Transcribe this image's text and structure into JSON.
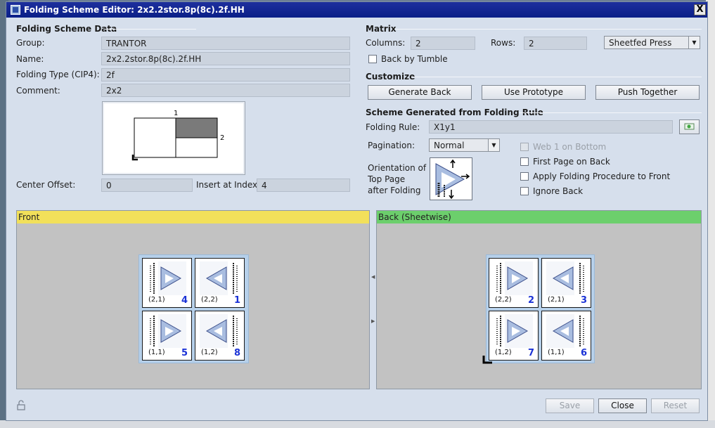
{
  "window": {
    "title": "Folding Scheme Editor: 2x2.2stor.8p(8c).2f.HH",
    "close_glyph": "X"
  },
  "folding_scheme_data": {
    "heading": "Folding Scheme Data",
    "group_label": "Group:",
    "group_value": "TRANTOR",
    "name_label": "Name:",
    "name_value": "2x2.2stor.8p(8c).2f.HH",
    "folding_type_label": "Folding Type (CIP4):",
    "folding_type_value": "2f",
    "comment_label": "Comment:",
    "comment_value": "2x2",
    "preview": {
      "top_number": "1",
      "right_number": "2"
    },
    "center_offset_label": "Center Offset:",
    "center_offset_value": "0",
    "insert_at_index_label": "Insert at Index",
    "insert_at_index_value": "4"
  },
  "matrix": {
    "heading": "Matrix",
    "columns_label": "Columns:",
    "columns_value": "2",
    "rows_label": "Rows:",
    "rows_value": "2",
    "press_value": "Sheetfed Press",
    "back_by_tumble_label": "Back by Tumble"
  },
  "customize": {
    "heading": "Customize",
    "generate_back": "Generate Back",
    "use_prototype": "Use Prototype",
    "push_together": "Push Together"
  },
  "scheme_generated": {
    "heading": "Scheme Generated from Folding Rule",
    "folding_rule_label": "Folding Rule:",
    "folding_rule_value": "X1y1",
    "pagination_label": "Pagination:",
    "pagination_value": "Normal",
    "orientation_label_1": "Orientation of",
    "orientation_label_2": "Top Page",
    "orientation_label_3": "after Folding",
    "web1_on_bottom": "Web 1 on Bottom",
    "first_page_on_back": "First Page on Back",
    "apply_folding_procedure": "Apply Folding Procedure to Front",
    "ignore_back": "Ignore Back"
  },
  "front": {
    "title": "Front",
    "header_color": "#f2e05a",
    "tiles": [
      {
        "coord": "(2,1)",
        "page": "4"
      },
      {
        "coord": "(2,2)",
        "page": "1"
      },
      {
        "coord": "(1,1)",
        "page": "5"
      },
      {
        "coord": "(1,2)",
        "page": "8"
      }
    ]
  },
  "back": {
    "title": "Back (Sheetwise)",
    "header_color": "#6ccf6c",
    "tiles": [
      {
        "coord": "(2,2)",
        "page": "2"
      },
      {
        "coord": "(2,1)",
        "page": "3"
      },
      {
        "coord": "(1,2)",
        "page": "7"
      },
      {
        "coord": "(1,1)",
        "page": "6"
      }
    ]
  },
  "footer": {
    "save": "Save",
    "close": "Close",
    "reset": "Reset"
  },
  "icons": {
    "lock": "lock-icon",
    "folding_rule_button": "folding-rule-icon",
    "orientation": "orientation-icon"
  }
}
